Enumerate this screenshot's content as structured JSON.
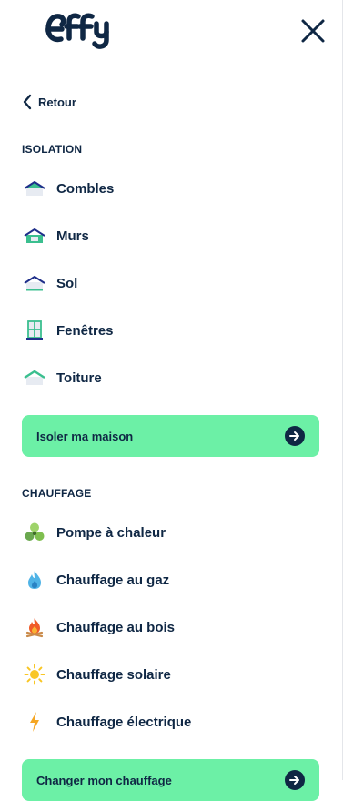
{
  "header": {
    "logo_text": "effy",
    "close_icon": "close-icon"
  },
  "back": {
    "label": "Retour"
  },
  "isolation": {
    "title": "ISOLATION",
    "items": [
      {
        "label": "Combles",
        "icon": "attic-icon"
      },
      {
        "label": "Murs",
        "icon": "walls-icon"
      },
      {
        "label": "Sol",
        "icon": "floor-icon"
      },
      {
        "label": "Fenêtres",
        "icon": "window-icon"
      },
      {
        "label": "Toiture",
        "icon": "roof-icon"
      }
    ],
    "cta": "Isoler ma maison"
  },
  "chauffage": {
    "title": "CHAUFFAGE",
    "items": [
      {
        "label": "Pompe à chaleur",
        "icon": "heat-pump-icon"
      },
      {
        "label": "Chauffage au gaz",
        "icon": "gas-flame-icon"
      },
      {
        "label": "Chauffage au bois",
        "icon": "wood-fire-icon"
      },
      {
        "label": "Chauffage solaire",
        "icon": "sun-icon"
      },
      {
        "label": "Chauffage électrique",
        "icon": "lightning-icon"
      }
    ],
    "cta": "Changer mon chauffage"
  },
  "colors": {
    "navy": "#0f2744",
    "green": "#6cf0a6",
    "teal": "#3bbf8f"
  }
}
